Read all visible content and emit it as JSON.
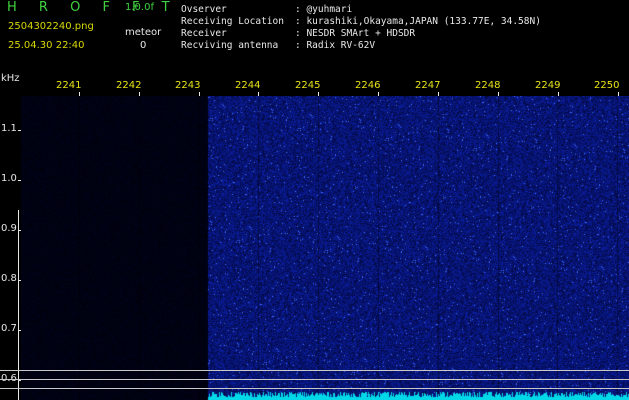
{
  "header": {
    "logo": "H R O F F T",
    "version": "1.0.0f",
    "filename": "2504302240.png",
    "datetime": "25.04.30 22:40",
    "meteor_label": "meteor",
    "meteor_count": "0"
  },
  "info": [
    {
      "key": "Ovserver",
      "value": ": @yuhmari"
    },
    {
      "key": "Receiving Location",
      "value": ": kurashiki,Okayama,JAPAN (133.77E, 34.58N)"
    },
    {
      "key": "Receiver",
      "value": ": NESDR SMArt + HDSDR"
    },
    {
      "key": "Recviving antenna",
      "value": ": Radix RV-62V"
    }
  ],
  "axis": {
    "y_unit": "kHz",
    "time_labels": [
      "2241",
      "2242",
      "2243",
      "2244",
      "2245",
      "2246",
      "2247",
      "2248",
      "2249",
      "2250"
    ],
    "freq_labels": [
      "1.1",
      "1.0",
      "0.9",
      "0.8",
      "0.7",
      "0.6"
    ]
  },
  "colors": {
    "background": "#000000",
    "logo": "#3fd23f",
    "filename": "#d8d800",
    "time_labels": "#e8e414",
    "text": "#e8e8e8",
    "noise": "#2830c8",
    "baseline": "#00d8e8"
  },
  "chart_data": {
    "type": "heatmap",
    "x": [
      "2241",
      "2242",
      "2243",
      "2244",
      "2245",
      "2246",
      "2247",
      "2248",
      "2249",
      "2250"
    ],
    "ylabel": "kHz",
    "y_ticks": [
      1.1,
      1.0,
      0.9,
      0.8,
      0.7,
      0.6
    ],
    "dark_until_time": "2244",
    "meteor_count": 0
  }
}
